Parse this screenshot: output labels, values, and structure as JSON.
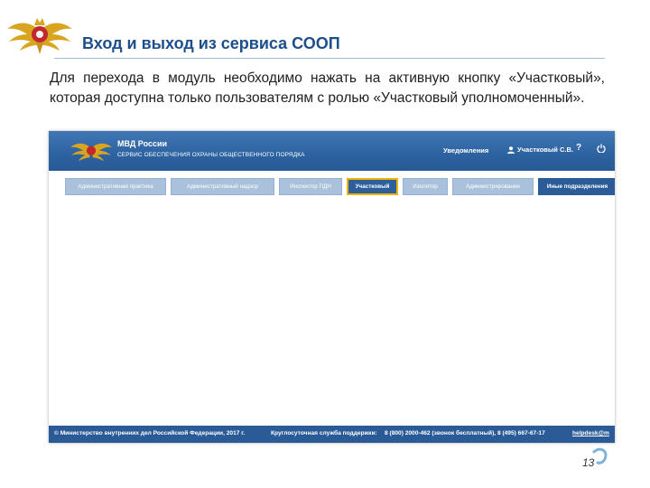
{
  "slide": {
    "title": "Вход и выход из сервиса СООП",
    "description": "Для перехода в модуль необходимо нажать на активную кнопку «Участковый», которая доступна только пользователям с ролью «Участковый уполномоченный».",
    "page_number": "13"
  },
  "app": {
    "org_name": "МВД России",
    "service_name": "СЕРВИС ОБЕСПЕЧЕНИЯ ОХРАНЫ ОБЩЕСТВЕННОГО ПОРЯДКА",
    "notifications_label": "Уведомления",
    "user_name": "Участковый С.В.",
    "help_label": "?",
    "nav": {
      "admin_practice": "Административная практика",
      "admin_supervision": "Административный надзор",
      "pdn_inspector": "Инспектор ПДН",
      "district": "Участковый",
      "isolator": "Изолятор",
      "administration": "Администрирование",
      "other_units": "Иные подразделения"
    },
    "footer": {
      "copyright": "© Министерство внутренних дел Российской Федерации, 2017 г.",
      "support_label": "Круглосуточная служба поддержки:",
      "phones": "8 (800) 2000-462 (звонок бесплатный), 8 (495) 667-67-17",
      "email": "helpdesk@m"
    }
  },
  "colors": {
    "header_blue": "#2d62a0",
    "active_outline": "#f0b400",
    "title_blue": "#1d4f8c"
  }
}
